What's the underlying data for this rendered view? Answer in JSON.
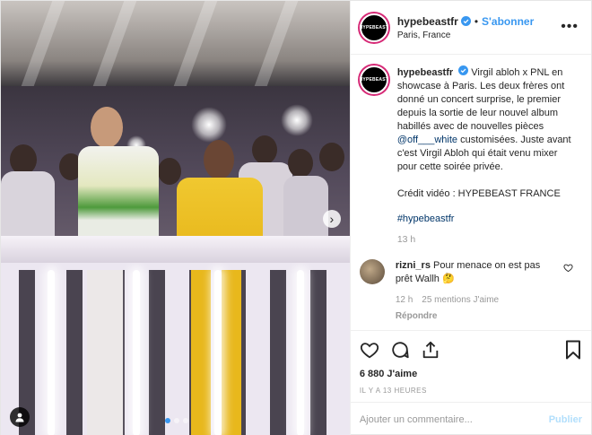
{
  "header": {
    "username": "hypebeastfr",
    "separator": "•",
    "follow_label": "S'abonner",
    "location": "Paris, France",
    "avatar_text": "HYPEBEAST",
    "more_icon": "more-horizontal-icon"
  },
  "caption": {
    "username": "hypebeastfr",
    "avatar_text": "HYPEBEAST",
    "text_part1": "Virgil abloh x PNL en showcase à Paris. Les deux frères ont donné un concert surprise, le premier depuis la sortie de leur nouvel album habillés avec de nouvelles pièces ",
    "mention": "@off___white",
    "text_part2": " customisées. Juste avant c'est Virgil Abloh qui était venu mixer pour cette soirée privée.",
    "credit": "Crédit vidéo : HYPEBEAST FRANCE",
    "hashtag": "#hypebeastfr",
    "time": "13 h"
  },
  "comments": [
    {
      "username": "rizni_rs",
      "text": "Pour menace on est pas prêt Wallh 🤔",
      "time": "12 h",
      "likes": "25 mentions J'aime",
      "reply_label": "Répondre"
    }
  ],
  "actions": {
    "likes": "6 880 J'aime",
    "timeago": "IL Y A 13 HEURES"
  },
  "add_comment": {
    "placeholder": "Ajouter un commentaire...",
    "publish_label": "Publier"
  },
  "colors": {
    "accent": "#3897f0",
    "link": "#003569",
    "muted": "#999999",
    "publish_disabled": "#b2dffc"
  }
}
